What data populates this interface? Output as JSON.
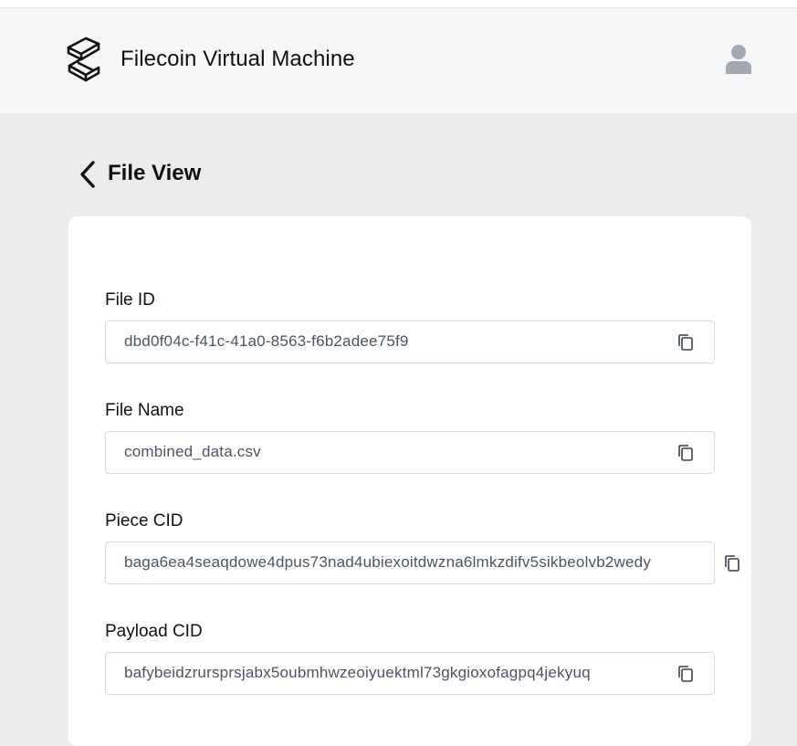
{
  "app": {
    "title": "Filecoin Virtual Machine"
  },
  "page": {
    "title": "File View"
  },
  "icons": {
    "logo": "fvm-logo-icon",
    "user": "user-icon",
    "back": "chevron-left-icon",
    "copy": "copy-icon"
  },
  "colors": {
    "header_bg": "#f5f6f8",
    "page_bg": "#ececec",
    "card_bg": "#ffffff",
    "value_text": "#4b5563"
  },
  "fields": [
    {
      "label": "File ID",
      "value": "dbd0f04c-f41c-41a0-8563-f6b2adee75f9"
    },
    {
      "label": "File Name",
      "value": "combined_data.csv"
    },
    {
      "label": "Piece CID",
      "value": "baga6ea4seaqdowe4dpus73nad4ubiexoitdwzna6lmkzdifv5sikbeolvb2wedy"
    },
    {
      "label": "Payload CID",
      "value": "bafybeidzrursprsjabx5oubmhwzeoiyuektml73gkgioxofagpq4jekyuq"
    }
  ]
}
